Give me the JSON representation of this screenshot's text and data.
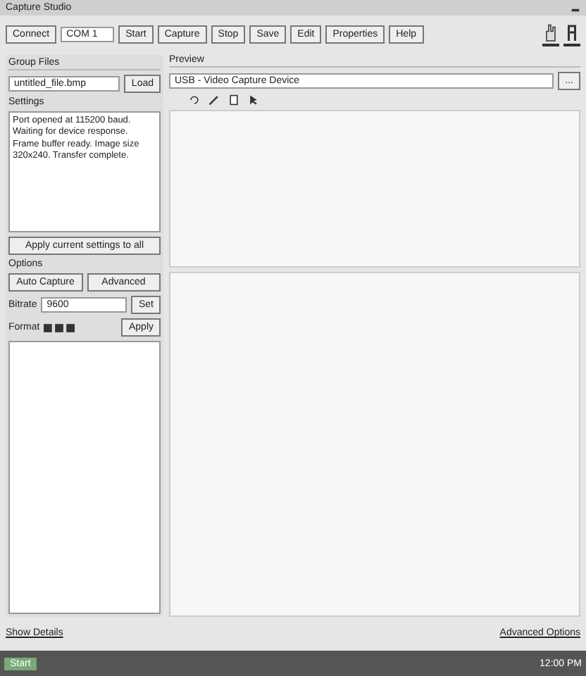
{
  "window": {
    "title": "Capture Studio"
  },
  "toolbar": {
    "buttons": [
      "Connect",
      "Start",
      "Capture",
      "Stop",
      "Save",
      "Edit",
      "Properties",
      "Help"
    ],
    "port": "COM 1"
  },
  "left": {
    "header": "Group Files",
    "file_field": "untitled_file.bmp",
    "browse": "Load",
    "notes_label": "Settings",
    "notes": "Port opened at 115200 baud. Waiting for device response. Frame buffer ready. Image size 320x240. Transfer complete.",
    "apply_all": "Apply current settings to all",
    "options_label": "Options",
    "opt_buttons": [
      "Auto Capture",
      "Advanced"
    ],
    "bitrate_label": "Bitrate",
    "bitrate": "9600",
    "bitrate_btn": "Set",
    "mode_label": "Format",
    "mode_btn": "Apply"
  },
  "right": {
    "header": "Preview",
    "source": "USB - Video Capture Device",
    "go": "..."
  },
  "footer": {
    "left_link": "Show Details",
    "right_link": "Advanced Options"
  },
  "taskbar": {
    "start": "Start",
    "clock": "12:00 PM"
  }
}
